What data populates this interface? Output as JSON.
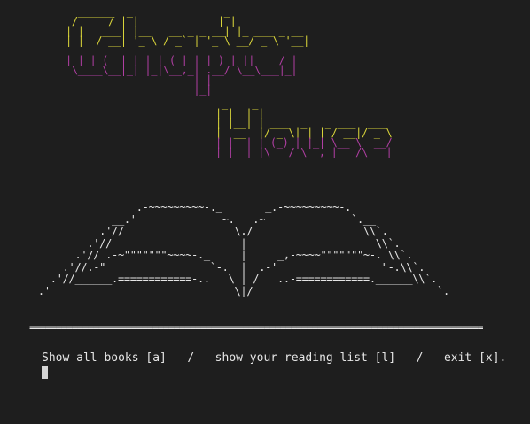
{
  "colors": {
    "background": "#1e1e1e",
    "logo_yellow": "#d9d43a",
    "logo_magenta": "#b03fa3",
    "text": "#e6e6e6",
    "cursor": "#d4d4d4"
  },
  "logo": {
    "chapter_top": "  ______  _               _\n / ____/ | |             | |\n| |   ___| |__   __ _ _ __| |_ ___ _ __\n| |  / __| '_ \\ / _` | '_ \\ __/ _ \\ '__|",
    "chapter_bottom": "| |_| (__| | | | (_| | |_) | ||  __/ |\n \\____\\__|_| |_|\\__,_| .__/ \\__\\___|_|\n                     | |\n                     |_|",
    "house_top": " _    _\n| |  | |\n| |__| | ___  _   _ ___  ___\n|  __  |/ _ \\| | | / __|/ _ \\",
    "house_bottom": "| |  | | (_) | |_| \\__ \\  __/\n|_|  |_|\\___/ \\__,_|___/\\___|"
  },
  "book_art": "                 .-~~~~~~~~~-._       _.-~~~~~~~~~-.\n             __.'              ~.   .~              `.__\n           .'//                  \\./                  \\\\`.\n         .'//                     |                     \\\\`.\n       .'// .-~\"\"\"\"\"\"\"~~~~-._     |     _,-~~~~\"\"\"\"\"\"\"~-. \\\\`.\n     .'//.-\"                 `-.  |  .-'                 \"-.\\\\`.\n   .'//______.============-..   \\ | /   ..-============.______\\\\`.\n .'______________________________\\|/______________________________`.",
  "divider": "==================================================================================================",
  "prompt": {
    "text": "Show all books [a]   /   show your reading list [l]   /   exit [x]."
  }
}
